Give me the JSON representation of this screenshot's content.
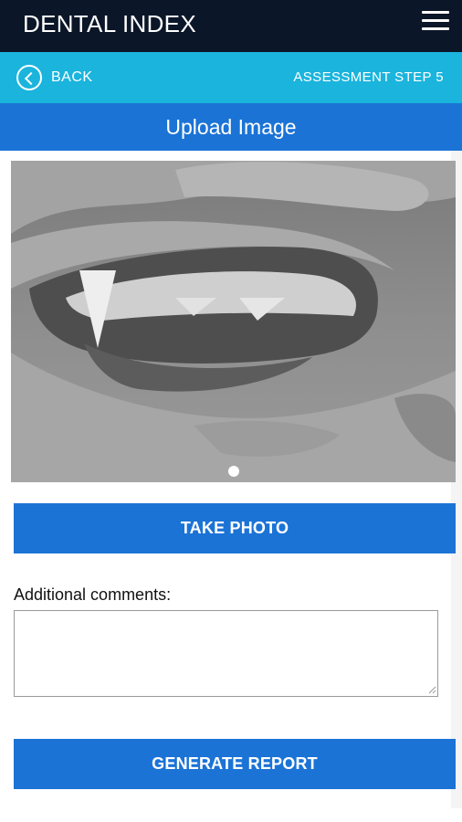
{
  "header": {
    "title": "DENTAL INDEX",
    "menu_icon": "hamburger-menu-icon"
  },
  "step_bar": {
    "back_label": "BACK",
    "back_icon": "back-arrow-circle-icon",
    "step_label": "ASSESSMENT STEP 5"
  },
  "page": {
    "title": "Upload Image"
  },
  "carousel": {
    "image_count": 1,
    "active_index": 0
  },
  "actions": {
    "take_photo": "TAKE PHOTO",
    "generate_report": "GENERATE REPORT"
  },
  "comments": {
    "label": "Additional comments:",
    "value": "",
    "placeholder": ""
  },
  "colors": {
    "header_bg": "#0b1628",
    "step_bar_bg": "#1ab4dd",
    "primary": "#1b73d6",
    "text": "#111111"
  }
}
